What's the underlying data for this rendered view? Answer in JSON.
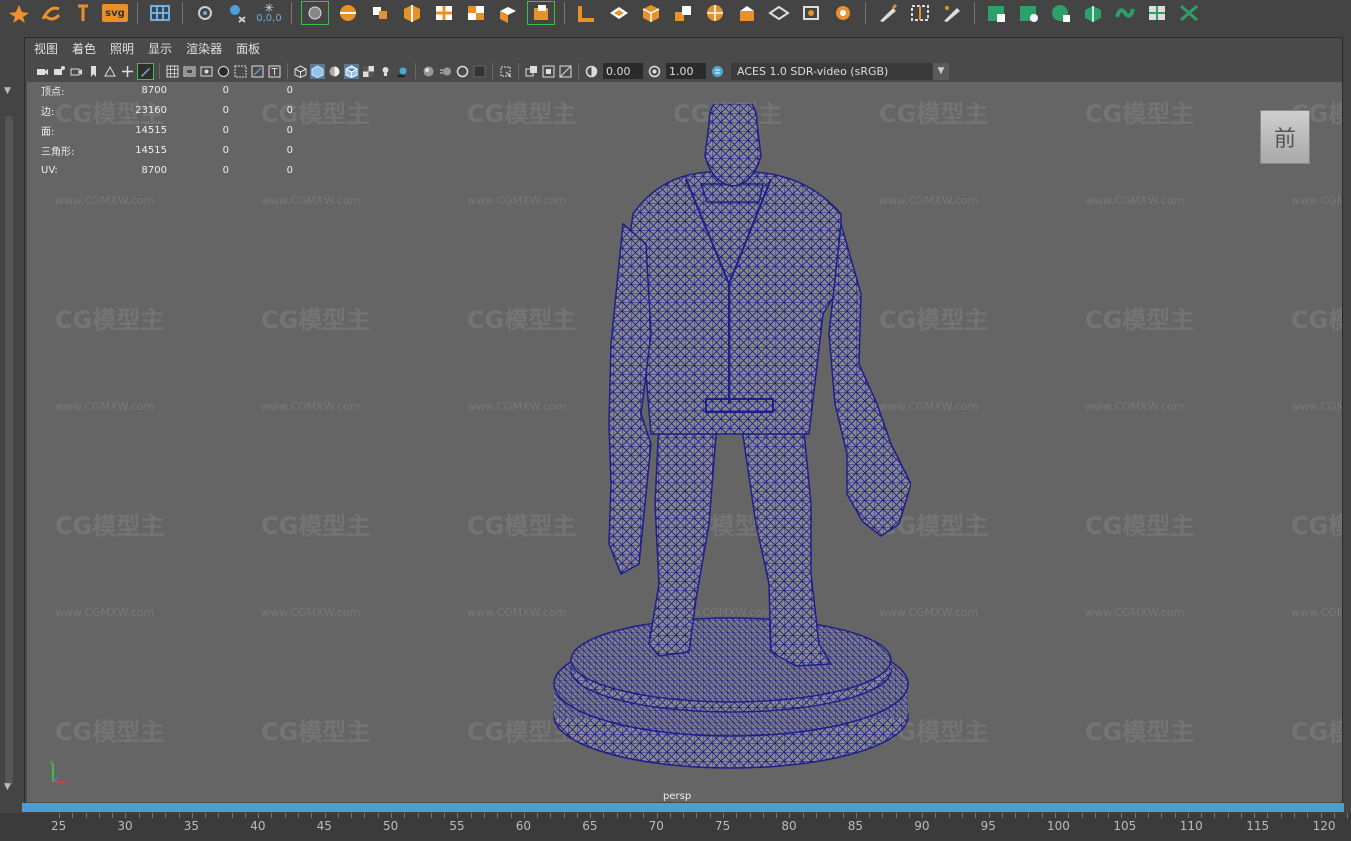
{
  "menu": [
    "视图",
    "着色",
    "照明",
    "显示",
    "渲染器",
    "面板"
  ],
  "shelf": {
    "svg_label": "svg",
    "coord_label": "0,0,0",
    "icons": [
      "vector-icon",
      "curve-icon",
      "text-icon",
      "svg-icon",
      "grid-icon",
      "snap-icon",
      "paint-icon",
      "coord-icon",
      "select-icon",
      "sphere-icon",
      "cube-icon",
      "boolean-icon",
      "combine-icon",
      "checker-icon",
      "extrude-icon",
      "bevel-icon",
      "bridge-icon",
      "fill-icon",
      "multicut-icon",
      "target-weld-icon",
      "wedge-icon",
      "quad-draw-icon",
      "smooth-icon",
      "pencil-icon",
      "crease-icon",
      "sculpt-icon",
      "uv-icon",
      "uv-editor-icon",
      "uv-unfold-icon",
      "uv-layout-icon",
      "uv-checker-icon",
      "uv-move-icon"
    ]
  },
  "viewport_toolbar": {
    "exposure": "0.00",
    "gamma": "1.00",
    "color_space": "ACES 1.0 SDR-video (sRGB)"
  },
  "hud": [
    {
      "label": "顶点:",
      "v1": "8700",
      "v2": "0",
      "v3": "0"
    },
    {
      "label": "边:",
      "v1": "23160",
      "v2": "0",
      "v3": "0"
    },
    {
      "label": "面:",
      "v1": "14515",
      "v2": "0",
      "v3": "0"
    },
    {
      "label": "三角形:",
      "v1": "14515",
      "v2": "0",
      "v3": "0"
    },
    {
      "label": "UV:",
      "v1": "8700",
      "v2": "0",
      "v3": "0"
    }
  ],
  "camera": "persp",
  "view_cube_label": "前",
  "watermark": {
    "logo": "CG模型主",
    "url": "www.CGMXW.com"
  },
  "ruler": [
    "25",
    "30",
    "35",
    "40",
    "45",
    "50",
    "55",
    "60",
    "65",
    "70",
    "75",
    "80",
    "85",
    "90",
    "95",
    "100",
    "105",
    "110",
    "115",
    "120"
  ],
  "colors": {
    "wire": "#1d1f8a",
    "timebar": "#4aa0d1",
    "viewport": "#656565"
  }
}
